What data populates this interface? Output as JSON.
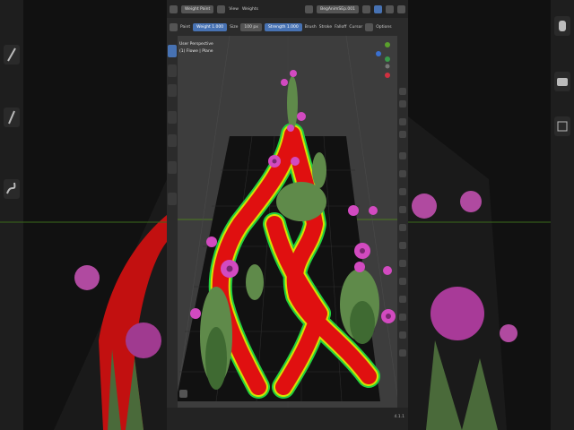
{
  "app": {
    "mode": "Weight Paint",
    "menus": [
      "View",
      "Weights"
    ],
    "file_name": "BegAnimSEp.001"
  },
  "tool_header": {
    "brush": "Paint",
    "weight_label": "Weight",
    "weight_value": "1.000",
    "size_label": "Size",
    "size_value": "100 px",
    "strength_label": "Strength",
    "strength_value": "1.000",
    "menus": [
      "Brush",
      "Stroke",
      "Falloff",
      "Cursor"
    ],
    "options": "Options"
  },
  "viewport": {
    "perspective": "User Perspective",
    "object": "(1) Flowe | Plane"
  },
  "status": {
    "version": "4.1.1"
  },
  "colors": {
    "accent": "#4772b3",
    "weight_red": "#e01010",
    "weight_yellow": "#d8e000",
    "weight_green": "#22d040",
    "flower": "#d24ac0",
    "leaf": "#5f8a4a"
  }
}
